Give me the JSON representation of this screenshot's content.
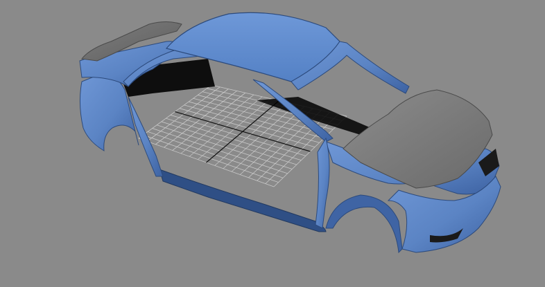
{
  "viewport": {
    "label": "",
    "background_color": "#8a8a8a",
    "model": {
      "name_icon": "car-body-shell-icon",
      "body_color": "#5d86c6",
      "body_shadow_color": "#2e4f86",
      "hood_color": "#7b7b7b",
      "spoiler_color": "#6f6f6f"
    },
    "grid": {
      "visible": true,
      "line_color": "#c9c9c9",
      "axis_color": "#111111"
    }
  }
}
